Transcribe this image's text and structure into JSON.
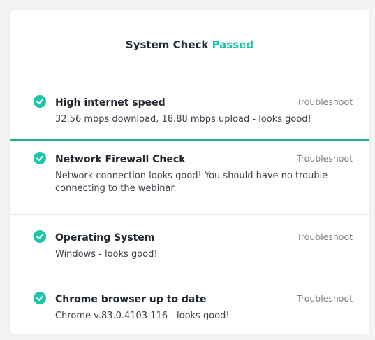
{
  "header": {
    "title_prefix": "System Check",
    "title_status": "Passed"
  },
  "checks": [
    {
      "title": "High internet speed",
      "action": "Troubleshoot",
      "description": "32.56 mbps download, 18.88 mbps upload - looks good!"
    },
    {
      "title": "Network Firewall Check",
      "action": "Troubleshoot",
      "description": "Network connection looks good! You should have no trouble connecting to the webinar."
    },
    {
      "title": "Operating System",
      "action": "Troubleshoot",
      "description": "Windows - looks good!"
    },
    {
      "title": "Chrome browser up to date",
      "action": "Troubleshoot",
      "description": "Chrome  v.83.0.4103.116 - looks good!"
    }
  ],
  "icons": {
    "check": "check-circle-icon"
  },
  "colors": {
    "accent": "#1cc5a8",
    "divider_active": "#1cb48f",
    "text_primary": "#222831",
    "text_muted": "#7a7f87"
  }
}
